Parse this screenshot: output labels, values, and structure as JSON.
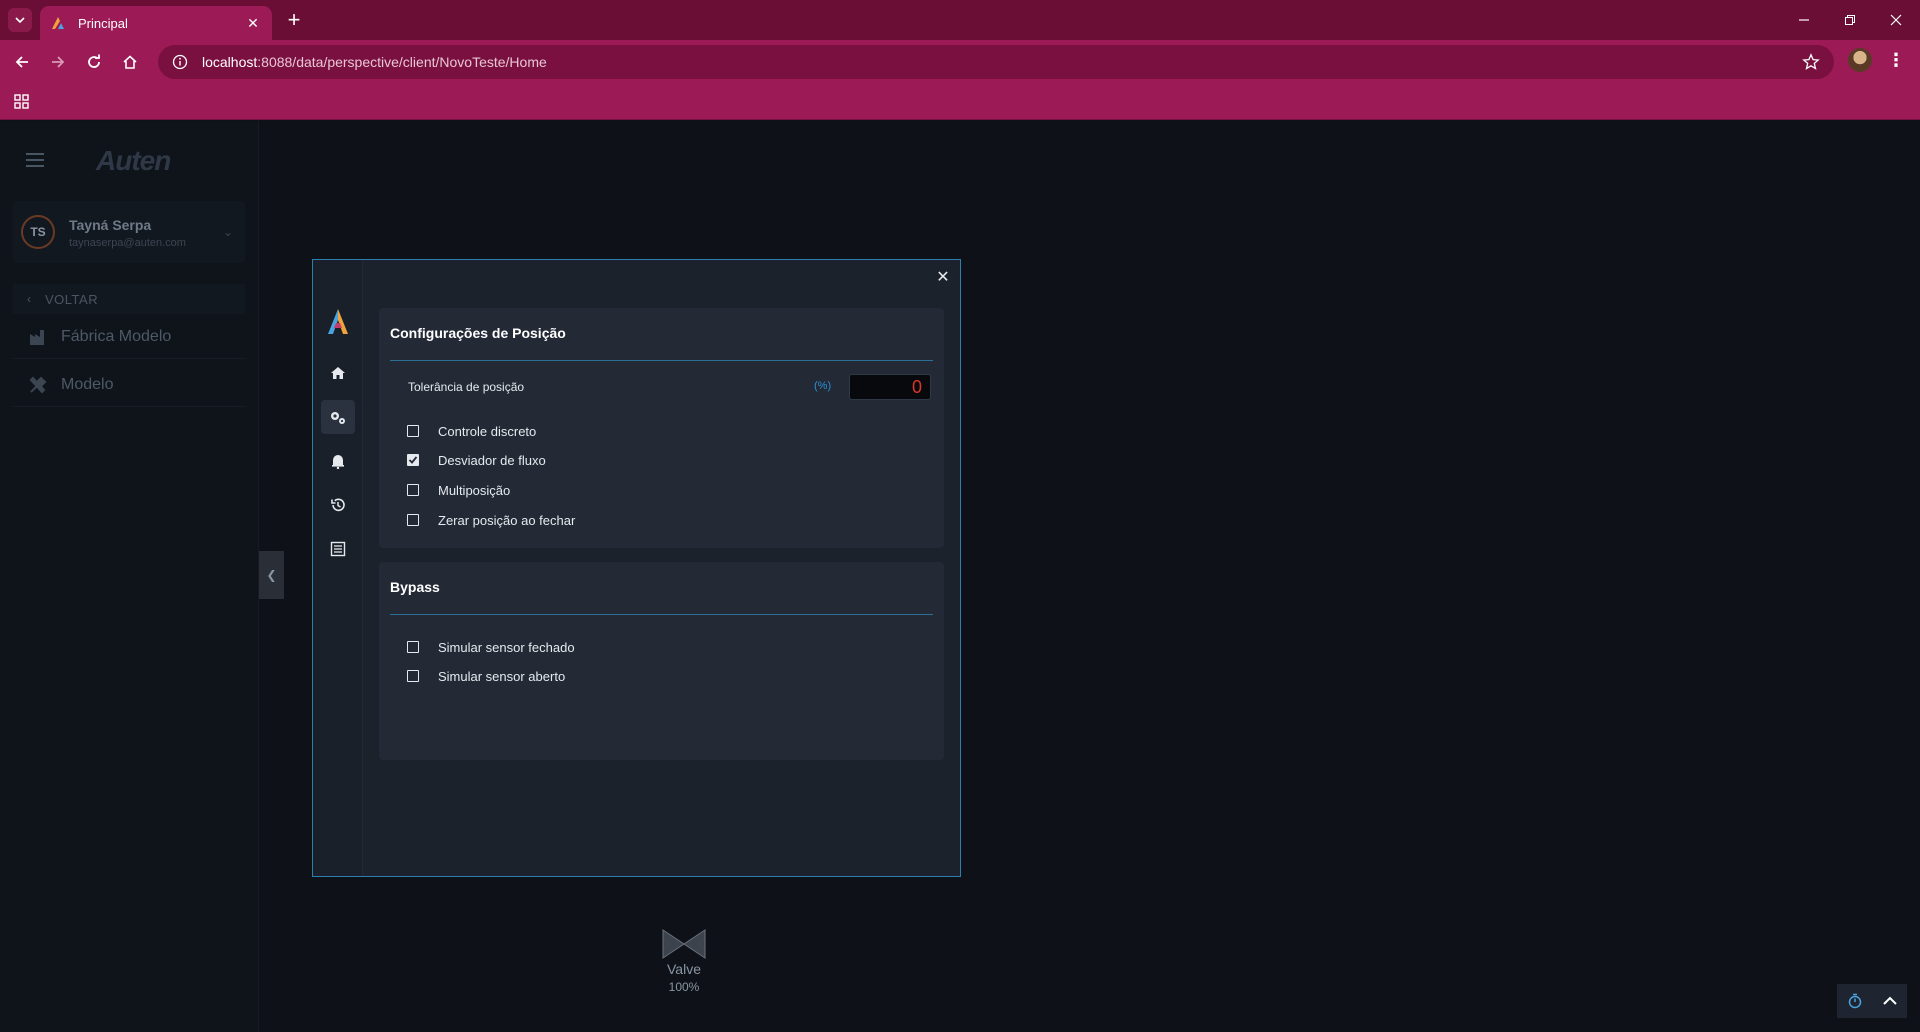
{
  "browser": {
    "tab_title": "Principal",
    "url_host": "localhost",
    "url_path": ":8088/data/perspective/client/NovoTeste/Home"
  },
  "sidebar": {
    "logo_text": "Auten",
    "user": {
      "initials": "TS",
      "name": "Tayná Serpa",
      "email": "taynaserpa@auten.com"
    },
    "back_label": "VOLTAR",
    "items": [
      {
        "label": "Fábrica Modelo",
        "icon": "factory-icon"
      },
      {
        "label": "Modelo",
        "icon": "tools-icon"
      }
    ]
  },
  "modal": {
    "position_card": {
      "title": "Configurações de Posição",
      "tolerance_label": "Tolerância de posição",
      "tolerance_unit": "(%)",
      "tolerance_value": "0",
      "checkboxes": [
        {
          "label": "Controle discreto",
          "checked": false
        },
        {
          "label": "Desviador de fluxo",
          "checked": true
        },
        {
          "label": "Multiposição",
          "checked": false
        },
        {
          "label": "Zerar posição ao fechar",
          "checked": false
        }
      ]
    },
    "bypass_card": {
      "title": "Bypass",
      "checkboxes": [
        {
          "label": "Simular sensor fechado",
          "checked": false
        },
        {
          "label": "Simular sensor aberto",
          "checked": false
        }
      ]
    }
  },
  "valve": {
    "name": "Valve",
    "percent": "100%"
  },
  "colors": {
    "chrome": "#9c1a55",
    "titlebar": "#6b0e36",
    "accent_blue": "#2c7fb0",
    "value_red": "#d9362b"
  }
}
